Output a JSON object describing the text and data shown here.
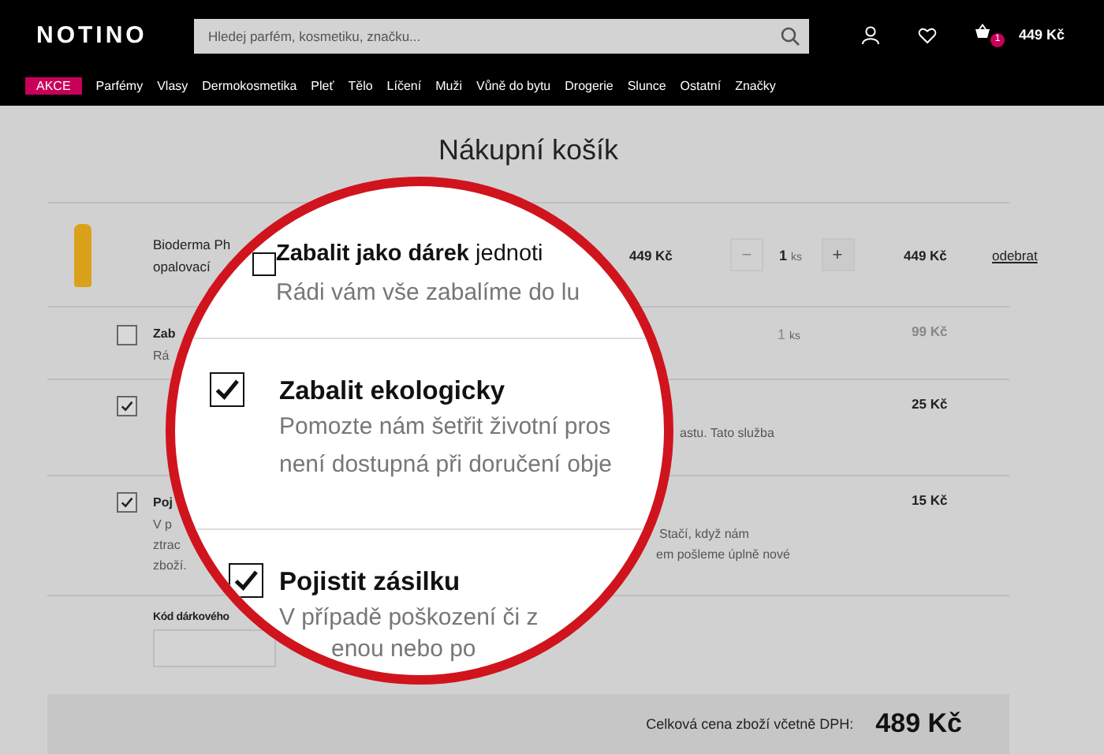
{
  "header": {
    "logo": "NOTINO",
    "search": {
      "placeholder": "Hledej parfém, kosmetiku, značku..."
    },
    "cart_count": "1",
    "cart_total": "449 Kč"
  },
  "nav": [
    {
      "label": "AKCE",
      "kind": "sale"
    },
    {
      "label": "Parfémy",
      "kind": "normal"
    },
    {
      "label": "Vlasy",
      "kind": "normal"
    },
    {
      "label": "Dermokosmetika",
      "kind": "normal"
    },
    {
      "label": "Pleť",
      "kind": "normal"
    },
    {
      "label": "Tělo",
      "kind": "normal"
    },
    {
      "label": "Líčení",
      "kind": "normal"
    },
    {
      "label": "Muži",
      "kind": "normal"
    },
    {
      "label": "Vůně do bytu",
      "kind": "normal"
    },
    {
      "label": "Drogerie",
      "kind": "normal"
    },
    {
      "label": "Slunce",
      "kind": "normal"
    },
    {
      "label": "Ostatní",
      "kind": "normal"
    },
    {
      "label": "Značky",
      "kind": "normal"
    }
  ],
  "title": "Nákupní košík",
  "product": {
    "name_lines": [
      "Bioderma Ph",
      "opalovací"
    ],
    "price": "449 Kč",
    "minus": {
      "label": "−",
      "disabled": true
    },
    "quantity": "1",
    "unit": "ks",
    "plus": {
      "label": "+",
      "disabled": false
    },
    "total": "449 Kč",
    "remove": "odebrat"
  },
  "services": [
    {
      "checked": false,
      "title": "Zab",
      "desc_lines": [
        "Rá"
      ],
      "quantity": "1",
      "unit": "ks",
      "price": "99 Kč"
    },
    {
      "checked": true,
      "right_lines": [
        "astu. Tato služba"
      ],
      "price": "25 Kč"
    },
    {
      "checked": true,
      "title": "Poj",
      "desc_lines": [
        "V p",
        "ztrac",
        "zboží."
      ],
      "right_lines": [
        "Stačí, když nám",
        "em pošleme úplně nové"
      ],
      "price": "15 Kč"
    }
  ],
  "voucher": {
    "label": "Kód dárkového"
  },
  "summary": {
    "label": "Celková cena zboží včetně DPH:",
    "total": "489 Kč"
  },
  "magnifier": {
    "items": [
      {
        "checked": false,
        "title": "**Zabalit jako dárek** jednoti",
        "lines": [
          "Rádi vám vše zabalíme do lu"
        ]
      },
      {
        "checked": true,
        "title": "Zabalit ekologicky",
        "lines": [
          "Pomozte nám šetřit životní pros",
          "není dostupná při doručení obje"
        ]
      },
      {
        "checked": true,
        "title": "Pojistit zásilku",
        "lines": [
          "V případě poškození či z",
          "enou nebo po"
        ]
      }
    ]
  }
}
